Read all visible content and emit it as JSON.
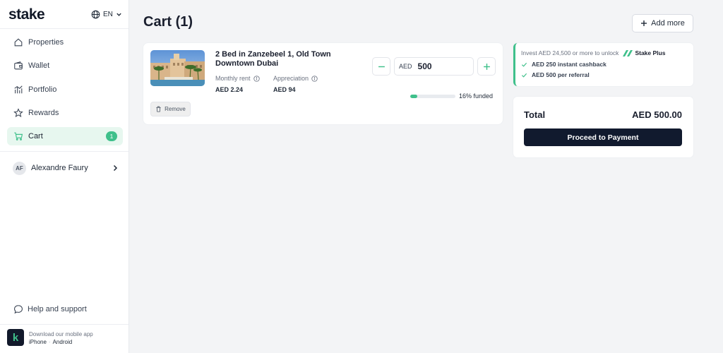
{
  "brand": {
    "logo_text": "stake",
    "accent": "#3fc08b",
    "dark": "#111a2e"
  },
  "language": {
    "label": "EN",
    "icon": "globe-icon"
  },
  "sidebar": {
    "items": [
      {
        "label": "Properties",
        "icon": "home-icon"
      },
      {
        "label": "Wallet",
        "icon": "wallet-icon"
      },
      {
        "label": "Portfolio",
        "icon": "chart-icon"
      },
      {
        "label": "Rewards",
        "icon": "star-icon"
      },
      {
        "label": "Cart",
        "icon": "cart-icon",
        "badge": "1",
        "active": true
      }
    ],
    "user": {
      "initials": "AF",
      "name": "Alexandre Faury"
    },
    "help_label": "Help and support",
    "app": {
      "title": "Download our mobile app",
      "iphone": "iPhone",
      "android": "Android"
    }
  },
  "main": {
    "title": "Cart (1)",
    "add_more_label": "Add more",
    "cart_item": {
      "name": "2 Bed in Zanzebeel 1, Old Town Downtown Dubai",
      "monthly_rent_label": "Monthly rent",
      "monthly_rent_value": "AED 2.24",
      "appreciation_label": "Appreciation",
      "appreciation_value": "AED 94",
      "remove_label": "Remove",
      "currency": "AED",
      "amount": "500",
      "funded_pct": 16,
      "funded_label": "16% funded"
    },
    "promo": {
      "intro": "Invest AED 24,500 or more to unlock",
      "plus_name": "Stake Plus",
      "benefits": [
        "AED 250 instant cashback",
        "AED 500 per referral"
      ]
    },
    "summary": {
      "total_label": "Total",
      "total_value": "AED 500.00",
      "pay_label": "Proceed to Payment"
    }
  }
}
